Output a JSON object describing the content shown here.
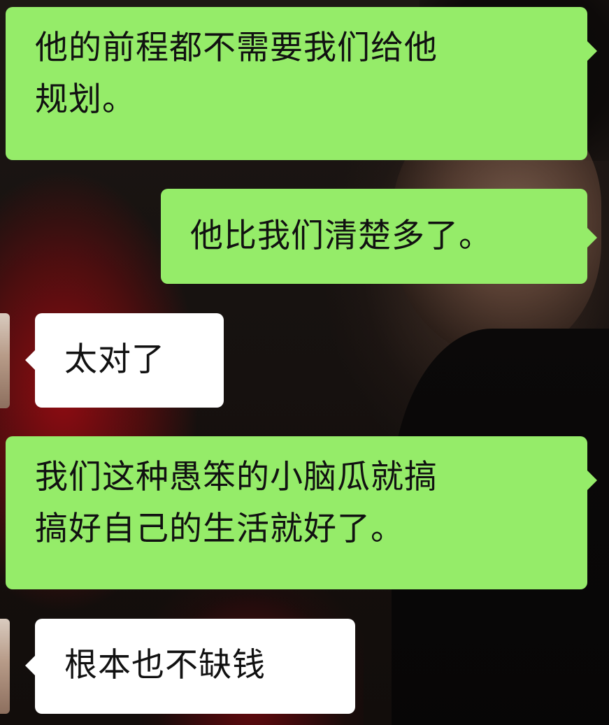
{
  "messages": [
    {
      "side": "right",
      "lines": [
        "他的前程都不需要我们给他",
        "规划。"
      ]
    },
    {
      "side": "right",
      "lines": [
        "他比我们清楚多了。"
      ]
    },
    {
      "side": "left",
      "lines": [
        "太对了"
      ]
    },
    {
      "side": "right",
      "lines": [
        "我们这种愚笨的小脑瓜就搞",
        "搞好自己的生活就好了。"
      ]
    },
    {
      "side": "left",
      "lines": [
        "根本也不缺钱"
      ]
    }
  ],
  "colors": {
    "sent_bubble": "#95ec69",
    "received_bubble": "#ffffff",
    "text": "#111111"
  }
}
